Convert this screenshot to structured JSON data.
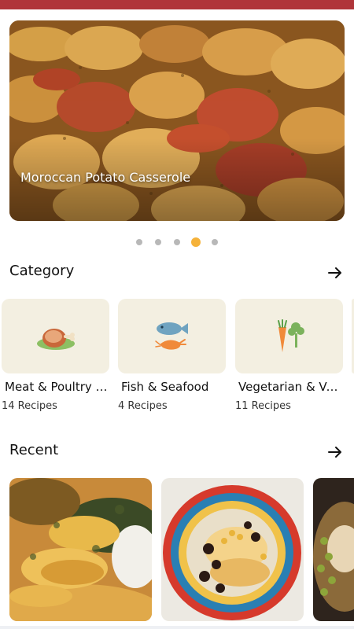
{
  "header": {
    "accent_color": "#b0353a"
  },
  "hero": {
    "title": "Moroccan Potato Casserole",
    "image_icon": "potato-casserole-photo",
    "page_count": 5,
    "active_page": 4
  },
  "category": {
    "title": "Category",
    "arrow_icon": "arrow-right-icon",
    "items": [
      {
        "name": "Meat & Poultry Dishes",
        "count": "14 Recipes",
        "icon": "meat-icon"
      },
      {
        "name": "Fish & Seafood",
        "count": "4 Recipes",
        "icon": "fish-seafood-icon"
      },
      {
        "name": "Vegetarian & Vegan",
        "count": "11 Recipes",
        "icon": "vegetables-icon"
      }
    ]
  },
  "recent": {
    "title": "Recent",
    "arrow_icon": "arrow-right-icon",
    "items": [
      {
        "icon": "roast-chicken-photo"
      },
      {
        "icon": "chicken-olive-tagine-photo"
      },
      {
        "icon": "olive-dish-photo"
      }
    ]
  },
  "colors": {
    "accent_dot": "#f5b23a",
    "dot": "#b8b8b8",
    "tile_bg": "#f3efe1"
  }
}
